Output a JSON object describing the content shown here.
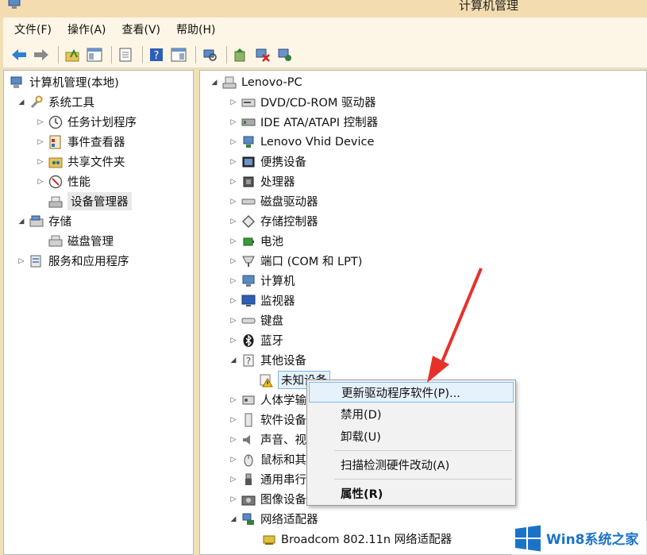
{
  "window": {
    "title": "计算机管理"
  },
  "menubar": [
    "文件(F)",
    "操作(A)",
    "查看(V)",
    "帮助(H)"
  ],
  "left_tree": [
    {
      "label": "计算机管理(本地)",
      "icon": "computer-management-icon",
      "expander": ""
    },
    {
      "label": "系统工具",
      "icon": "system-tools-icon",
      "expander": "◢"
    },
    {
      "label": "任务计划程序",
      "icon": "clock-icon",
      "expander": "▷"
    },
    {
      "label": "事件查看器",
      "icon": "event-viewer-icon",
      "expander": "▷"
    },
    {
      "label": "共享文件夹",
      "icon": "shared-folder-icon",
      "expander": "▷"
    },
    {
      "label": "性能",
      "icon": "performance-icon",
      "expander": "▷"
    },
    {
      "label": "设备管理器",
      "icon": "device-manager-icon",
      "expander": ""
    },
    {
      "label": "存储",
      "icon": "storage-icon",
      "expander": "◢"
    },
    {
      "label": "磁盘管理",
      "icon": "disk-management-icon",
      "expander": ""
    },
    {
      "label": "服务和应用程序",
      "icon": "services-icon",
      "expander": "▷"
    }
  ],
  "right_tree": [
    {
      "label": "Lenovo-PC",
      "icon": "computer-icon",
      "expander": "◢"
    },
    {
      "label": "DVD/CD-ROM 驱动器",
      "icon": "dvd-drive-icon",
      "expander": "▷"
    },
    {
      "label": "IDE ATA/ATAPI 控制器",
      "icon": "ide-controller-icon",
      "expander": "▷"
    },
    {
      "label": "Lenovo Vhid Device",
      "icon": "hid-device-icon",
      "expander": "▷"
    },
    {
      "label": "便携设备",
      "icon": "portable-device-icon",
      "expander": "▷"
    },
    {
      "label": "处理器",
      "icon": "processor-icon",
      "expander": "▷"
    },
    {
      "label": "磁盘驱动器",
      "icon": "disk-drive-icon",
      "expander": "▷"
    },
    {
      "label": "存储控制器",
      "icon": "storage-controller-icon",
      "expander": "▷"
    },
    {
      "label": "电池",
      "icon": "battery-icon",
      "expander": "▷"
    },
    {
      "label": "端口 (COM 和 LPT)",
      "icon": "port-icon",
      "expander": "▷"
    },
    {
      "label": "计算机",
      "icon": "computer-icon",
      "expander": "▷"
    },
    {
      "label": "监视器",
      "icon": "monitor-icon",
      "expander": "▷"
    },
    {
      "label": "键盘",
      "icon": "keyboard-icon",
      "expander": "▷"
    },
    {
      "label": "蓝牙",
      "icon": "bluetooth-icon",
      "expander": "▷"
    },
    {
      "label": "其他设备",
      "icon": "other-devices-icon",
      "expander": "◢"
    },
    {
      "label": "未知设备",
      "icon": "warning-device-icon",
      "expander": ""
    },
    {
      "label": "人体学输",
      "icon": "hid-icon",
      "expander": "▷"
    },
    {
      "label": "软件设备",
      "icon": "software-device-icon",
      "expander": "▷"
    },
    {
      "label": "声音、视",
      "icon": "sound-icon",
      "expander": "▷"
    },
    {
      "label": "鼠标和其",
      "icon": "mouse-icon",
      "expander": "▷"
    },
    {
      "label": "通用串行",
      "icon": "usb-icon",
      "expander": "▷"
    },
    {
      "label": "图像设备",
      "icon": "imaging-device-icon",
      "expander": "▷"
    },
    {
      "label": "网络适配器",
      "icon": "network-adapter-icon",
      "expander": "◢"
    },
    {
      "label": "Broadcom 802.11n 网络适配器",
      "icon": "network-card-icon",
      "expander": ""
    }
  ],
  "context_menu": {
    "update_driver": "更新驱动程序软件(P)...",
    "disable": "禁用(D)",
    "uninstall": "卸载(U)",
    "scan": "扫描检测硬件改动(A)",
    "properties": "属性(R)"
  },
  "watermark": {
    "text": "Win8系统之家"
  },
  "colors": {
    "accent_arrow": "#e8302a",
    "highlight": "#e5f1fb",
    "watermark": "#1b73c8"
  }
}
